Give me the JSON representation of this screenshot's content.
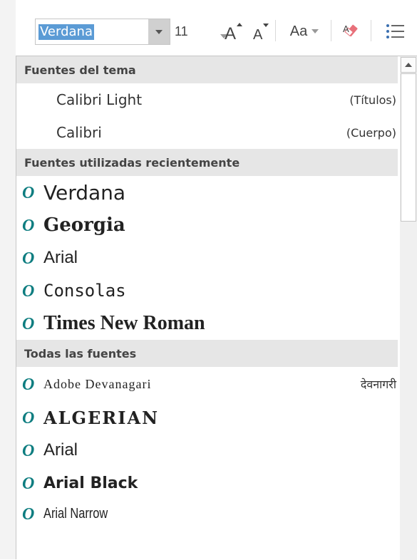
{
  "toolbar": {
    "font_name": "Verdana",
    "font_size": "11",
    "grow_font_label": "A",
    "shrink_font_label": "A",
    "change_case_label": "Aa"
  },
  "dropdown": {
    "sections": [
      {
        "header": "Fuentes del tema"
      },
      {
        "header": "Fuentes utilizadas recientemente"
      },
      {
        "header": "Todas las fuentes"
      }
    ],
    "theme_fonts": [
      {
        "name": "Calibri Light",
        "tag": "(Títulos)"
      },
      {
        "name": "Calibri",
        "tag": "(Cuerpo)"
      }
    ],
    "recent_fonts": [
      {
        "name": "Verdana"
      },
      {
        "name": "Georgia"
      },
      {
        "name": "Arial"
      },
      {
        "name": "Consolas"
      },
      {
        "name": "Times New Roman"
      }
    ],
    "all_fonts": [
      {
        "name": "Adobe Devanagari",
        "tag": "देवनागरी"
      },
      {
        "name": "ALGERIAN"
      },
      {
        "name": "Arial"
      },
      {
        "name": "Arial Black"
      },
      {
        "name": "Arial Narrow"
      }
    ]
  },
  "colors": {
    "selection": "#5b9bd5",
    "opentype_icon": "#0e7d80",
    "header_bg": "#e6e6e6"
  },
  "icons": [
    "chevron-down-icon",
    "grow-font-icon",
    "shrink-font-icon",
    "clear-formatting-icon",
    "bullets-icon",
    "opentype-font-icon",
    "scroll-up-icon"
  ]
}
